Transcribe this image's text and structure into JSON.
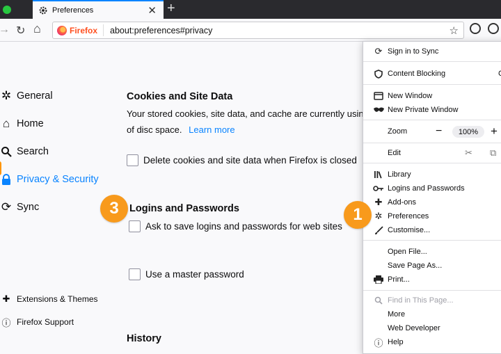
{
  "tab": {
    "title": "Preferences",
    "close_glyph": "✕",
    "newtab_glyph": "+"
  },
  "toolbar": {
    "back_glyph": "→",
    "reload_glyph": "↻",
    "home_glyph": "⌂",
    "star_glyph": "☆"
  },
  "urlbar": {
    "identity_label": "Firefox",
    "url": "about:preferences#privacy"
  },
  "sidebar": {
    "items": [
      {
        "label": "General",
        "icon": "gear-icon"
      },
      {
        "label": "Home",
        "icon": "home-icon"
      },
      {
        "label": "Search",
        "icon": "search-icon"
      },
      {
        "label": "Privacy & Security",
        "icon": "lock-icon",
        "active": true
      },
      {
        "label": "Sync",
        "icon": "sync-icon"
      }
    ],
    "footer": [
      {
        "label": "Extensions & Themes",
        "icon": "puzzle-icon"
      },
      {
        "label": "Firefox Support",
        "icon": "help-icon"
      }
    ]
  },
  "main": {
    "cookies": {
      "heading": "Cookies and Site Data",
      "desc_line1": "Your stored cookies, site data, and cache are currently usin",
      "desc_line2": "of disc space.",
      "learn_more": "Learn more",
      "delete_label": "Delete cookies and site data when Firefox is closed"
    },
    "logins": {
      "heading": "Logins and Passwords",
      "ask_label": "Ask to save logins and passwords for web sites",
      "master_label": "Use a master password"
    },
    "history": {
      "heading": "History"
    }
  },
  "badges": {
    "one": "1",
    "three": "3"
  },
  "menu": {
    "sign_in": "Sign in to Sync",
    "content_blocking": "Content Blocking",
    "content_blocking_trailing": "C",
    "new_window": "New Window",
    "new_private_window": "New Private Window",
    "zoom_label": "Zoom",
    "zoom_minus": "−",
    "zoom_value": "100%",
    "zoom_plus": "+",
    "edit_label": "Edit",
    "cut_glyph": "✂",
    "copy_glyph": "⧉",
    "library": "Library",
    "logins": "Logins and Passwords",
    "addons": "Add-ons",
    "preferences": "Preferences",
    "customise": "Customise...",
    "open_file": "Open File...",
    "save_page": "Save Page As...",
    "print": "Print...",
    "find": "Find in This Page...",
    "more": "More",
    "web_dev": "Web Developer",
    "help": "Help"
  },
  "colors": {
    "accent": "#0a84ff",
    "badge": "#f89a1c",
    "titlebar": "#2a2a2e"
  }
}
